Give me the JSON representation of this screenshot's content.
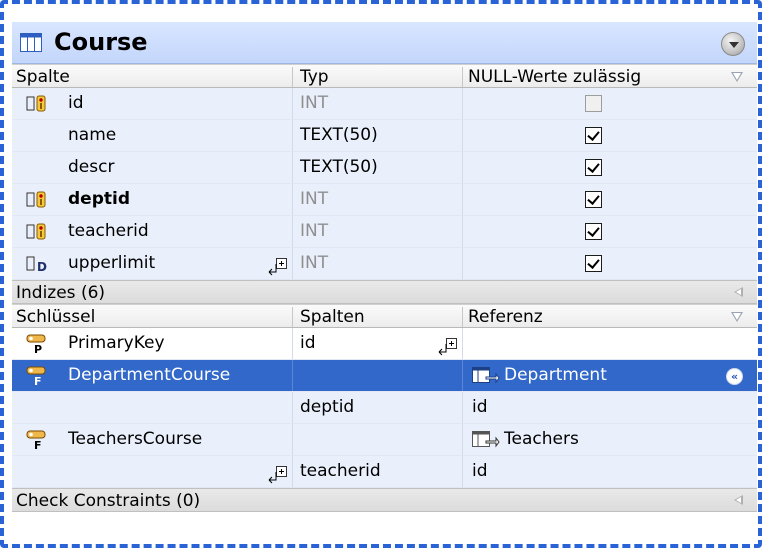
{
  "table": {
    "title": "Course"
  },
  "columns_header": {
    "col1": "Spalte",
    "col2": "Typ",
    "col3": "NULL-Werte zulässig"
  },
  "columns": [
    {
      "name": "id",
      "type": "INT",
      "nullable": false,
      "icon": "primary-foreign-key-icon",
      "bold": false,
      "type_gray": true
    },
    {
      "name": "name",
      "type": "TEXT(50)",
      "nullable": true,
      "icon": "",
      "bold": false,
      "type_gray": false
    },
    {
      "name": "descr",
      "type": "TEXT(50)",
      "nullable": true,
      "icon": "",
      "bold": false,
      "type_gray": false
    },
    {
      "name": "deptid",
      "type": "INT",
      "nullable": true,
      "icon": "primary-foreign-key-icon",
      "bold": true,
      "type_gray": true
    },
    {
      "name": "teacherid",
      "type": "INT",
      "nullable": true,
      "icon": "primary-foreign-key-icon",
      "bold": false,
      "type_gray": true
    },
    {
      "name": "upperlimit",
      "type": "INT",
      "nullable": true,
      "icon": "check-constraint-column-icon",
      "bold": false,
      "type_gray": true
    }
  ],
  "indexes_section": {
    "label": "Indizes (6)"
  },
  "keys_header": {
    "col1": "Schlüssel",
    "col2": "Spalten",
    "col3": "Referenz"
  },
  "keys": [
    {
      "name": "PrimaryKey",
      "column": "id",
      "reference": "",
      "icon": "primary-key-icon"
    },
    {
      "name": "DepartmentCourse",
      "column": "",
      "reference": "Department",
      "icon": "foreign-key-icon",
      "selected": true
    },
    {
      "name": "",
      "column": "deptid",
      "reference": "id"
    },
    {
      "name": "TeachersCourse",
      "column": "",
      "reference": "Teachers",
      "icon": "foreign-key-icon"
    },
    {
      "name": "",
      "column": "teacherid",
      "reference": "id"
    }
  ],
  "constraints_section": {
    "label": "Check Constraints (0)"
  },
  "colors": {
    "frame_border": "#2a63d6",
    "title_bg": "#c3d6fb",
    "row_bg": "#eaf0fb",
    "selection": "#3168c9"
  }
}
